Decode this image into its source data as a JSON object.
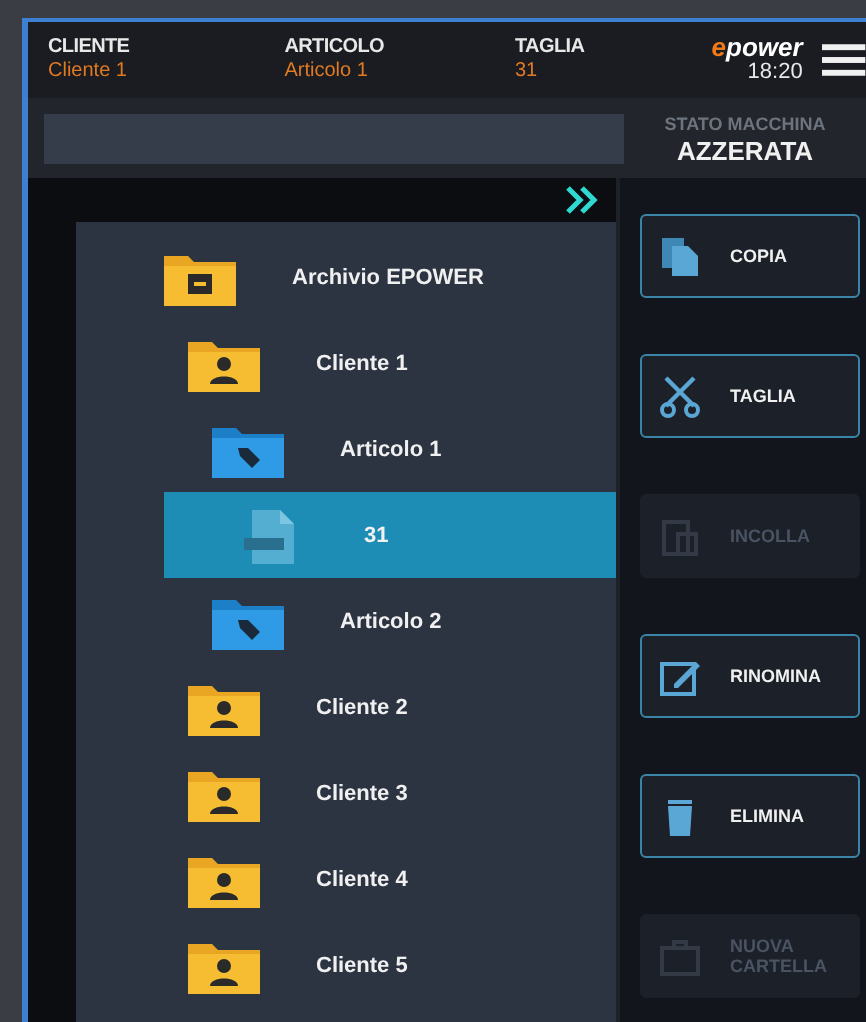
{
  "header": {
    "fields": [
      {
        "label": "CLIENTE",
        "value": "Cliente 1"
      },
      {
        "label": "ARTICOLO",
        "value": "Articolo 1"
      },
      {
        "label": "TAGLIA",
        "value": "31"
      }
    ],
    "logo": {
      "accent": "e",
      "rest": "power"
    },
    "time": "18:20"
  },
  "machine_state": {
    "label": "STATO MACCHINA",
    "value": "AZZERATA"
  },
  "tree": [
    {
      "label": "Archivio EPOWER",
      "kind": "archive",
      "selected": false,
      "children": [
        {
          "label": "Cliente 1",
          "kind": "client",
          "selected": false,
          "children": [
            {
              "label": "Articolo 1",
              "kind": "article",
              "selected": false,
              "children": [
                {
                  "label": "31",
                  "kind": "file",
                  "selected": true
                }
              ]
            },
            {
              "label": "Articolo 2",
              "kind": "article",
              "selected": false
            }
          ]
        },
        {
          "label": "Cliente 2",
          "kind": "client",
          "selected": false
        },
        {
          "label": "Cliente 3",
          "kind": "client",
          "selected": false
        },
        {
          "label": "Cliente 4",
          "kind": "client",
          "selected": false
        },
        {
          "label": "Cliente 5",
          "kind": "client",
          "selected": false
        }
      ]
    }
  ],
  "actions": [
    {
      "label": "COPIA",
      "kind": "copy",
      "disabled": false
    },
    {
      "label": "TAGLIA",
      "kind": "cut",
      "disabled": false
    },
    {
      "label": "INCOLLA",
      "kind": "paste",
      "disabled": true
    },
    {
      "label": "RINOMINA",
      "kind": "rename",
      "disabled": false
    },
    {
      "label": "ELIMINA",
      "kind": "delete",
      "disabled": false
    },
    {
      "label": "NUOVA CARTELLA",
      "kind": "new-folder",
      "disabled": true
    }
  ]
}
